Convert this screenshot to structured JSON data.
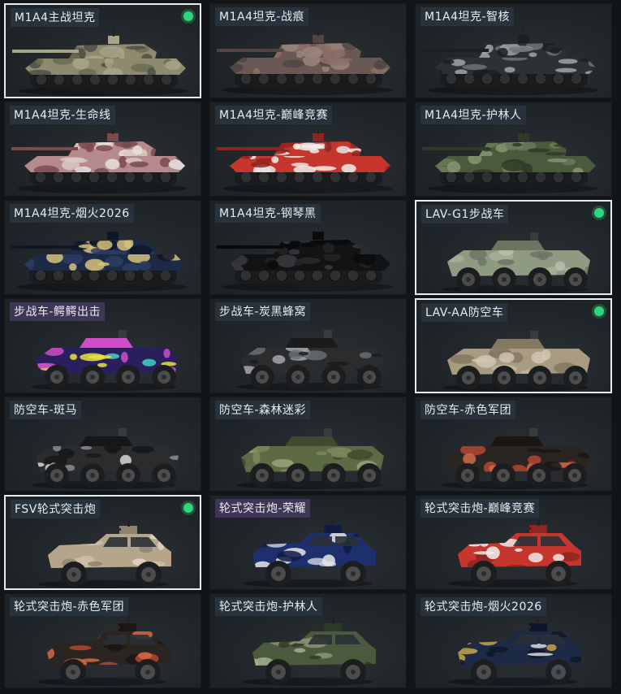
{
  "items": [
    {
      "name": "M1A4主战坦克",
      "type": "tank",
      "selected": true,
      "equipped": true,
      "tag": "blue",
      "camo": [
        "#8d8a6f",
        "#6b6a55",
        "#a8a488",
        "#4e4f45"
      ]
    },
    {
      "name": "M1A4坦克-战痕",
      "type": "tank",
      "selected": false,
      "equipped": false,
      "tag": "blue",
      "camo": [
        "#6b5754",
        "#8c6e68",
        "#4f4544",
        "#9a857c"
      ]
    },
    {
      "name": "M1A4坦克-智核",
      "type": "tank",
      "selected": false,
      "equipped": false,
      "tag": "blue",
      "camo": [
        "#2e3134",
        "#6e7378",
        "#1d1f21",
        "#a0a5aa"
      ]
    },
    {
      "name": "M1A4坦克-生命线",
      "type": "tank",
      "selected": false,
      "equipped": false,
      "tag": "blue",
      "camo": [
        "#b58a8d",
        "#d9c8c6",
        "#7a4a4e",
        "#e6e0de"
      ]
    },
    {
      "name": "M1A4坦克-巅峰竞赛",
      "type": "tank",
      "selected": false,
      "equipped": false,
      "tag": "blue",
      "camo": [
        "#c7362d",
        "#e8e4e2",
        "#8f2520",
        "#f1eeec"
      ]
    },
    {
      "name": "M1A4坦克-护林人",
      "type": "tank",
      "selected": false,
      "equipped": false,
      "tag": "blue",
      "camo": [
        "#4b5a3c",
        "#6b7a55",
        "#2f3a27",
        "#8a9470"
      ]
    },
    {
      "name": "M1A4坦克-烟火2026",
      "type": "tank",
      "selected": false,
      "equipped": false,
      "tag": "blue",
      "camo": [
        "#1d2a45",
        "#2c3d63",
        "#0f1628",
        "#d6c27a"
      ]
    },
    {
      "name": "M1A4坦克-钢琴黑",
      "type": "tank",
      "selected": false,
      "equipped": false,
      "tag": "blue",
      "camo": [
        "#121314",
        "#222426",
        "#0a0a0b",
        "#3a3c3f"
      ]
    },
    {
      "name": "LAV-G1步战车",
      "type": "apc",
      "selected": true,
      "equipped": true,
      "tag": "blue",
      "camo": [
        "#8f9a83",
        "#a7b09a",
        "#6c7564",
        "#b9c0ae"
      ]
    },
    {
      "name": "步战车-鳄鳄出击",
      "type": "apc",
      "selected": false,
      "equipped": false,
      "tag": "purple",
      "camo": [
        "#2a1f5c",
        "#3fd2c4",
        "#d04cc8",
        "#e8e43a"
      ]
    },
    {
      "name": "步战车-炭黑蜂窝",
      "type": "apc",
      "selected": false,
      "equipped": false,
      "tag": "blue",
      "camo": [
        "#2a2c2e",
        "#6b6e71",
        "#1a1b1c",
        "#a4a7aa"
      ]
    },
    {
      "name": "LAV-AA防空车",
      "type": "apc",
      "selected": true,
      "equipped": true,
      "tag": "blue",
      "camo": [
        "#a99b82",
        "#c1b59c",
        "#857861",
        "#d0c6b2"
      ]
    },
    {
      "name": "防空车-斑马",
      "type": "apc",
      "selected": false,
      "equipped": false,
      "tag": "blue",
      "camo": [
        "#2a2c2e",
        "#d6d6d6",
        "#161718",
        "#8a8c8e"
      ]
    },
    {
      "name": "防空车-森林迷彩",
      "type": "apc",
      "selected": false,
      "equipped": false,
      "tag": "blue",
      "camo": [
        "#5c6b44",
        "#7e8a5c",
        "#3f4a2e",
        "#9aa37a"
      ]
    },
    {
      "name": "防空车-赤色军团",
      "type": "apc",
      "selected": false,
      "equipped": false,
      "tag": "blue",
      "camo": [
        "#2b2522",
        "#b5472f",
        "#1a1614",
        "#d06a45"
      ]
    },
    {
      "name": "FSV轮式突击炮",
      "type": "truck",
      "selected": true,
      "equipped": true,
      "tag": "blue",
      "camo": [
        "#b5a58b",
        "#cdbfa6",
        "#8f8270",
        "#e0d6c3"
      ]
    },
    {
      "name": "轮式突击炮-荣耀",
      "type": "truck",
      "selected": false,
      "equipped": false,
      "tag": "purple",
      "camo": [
        "#1e2f6e",
        "#e6e6e6",
        "#0f1a45",
        "#c7cbd6"
      ]
    },
    {
      "name": "轮式突击炮-巅峰竞赛",
      "type": "truck",
      "selected": false,
      "equipped": false,
      "tag": "blue",
      "camo": [
        "#c7362d",
        "#eeeae7",
        "#8f2520",
        "#f4f2f0"
      ]
    },
    {
      "name": "轮式突击炮-赤色军团",
      "type": "truck",
      "selected": false,
      "equipped": false,
      "tag": "blue",
      "camo": [
        "#2b2522",
        "#b5472f",
        "#1a1614",
        "#d06a45"
      ]
    },
    {
      "name": "轮式突击炮-护林人",
      "type": "truck",
      "selected": false,
      "equipped": false,
      "tag": "blue",
      "camo": [
        "#4b5a3c",
        "#8a9470",
        "#2f3a27",
        "#a6ad8e"
      ]
    },
    {
      "name": "轮式突击炮-烟火2026",
      "type": "truck",
      "selected": false,
      "equipped": false,
      "tag": "blue",
      "camo": [
        "#1d2a45",
        "#d9d9e0",
        "#0f1628",
        "#c8a24a"
      ]
    }
  ]
}
